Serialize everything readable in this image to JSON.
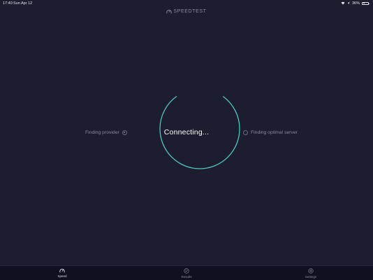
{
  "status_bar": {
    "time": "17:40",
    "date": "Sun Apr 12",
    "battery": "36%",
    "battery_level": 0.36
  },
  "header": {
    "logo_text": "SPEEDTEST"
  },
  "main": {
    "status_text": "Connecting...",
    "provider_label": "Finding provider",
    "server_label": "Finding optimal server"
  },
  "colors": {
    "background": "#1c1d2e",
    "accent": "#5ad4d0",
    "tab_bar": "#0f1020"
  },
  "tabs": [
    {
      "label": "Speed",
      "icon": "speedometer-icon",
      "active": true
    },
    {
      "label": "Results",
      "icon": "checkmark-circle-icon",
      "active": false
    },
    {
      "label": "Settings",
      "icon": "gear-icon",
      "active": false
    }
  ]
}
